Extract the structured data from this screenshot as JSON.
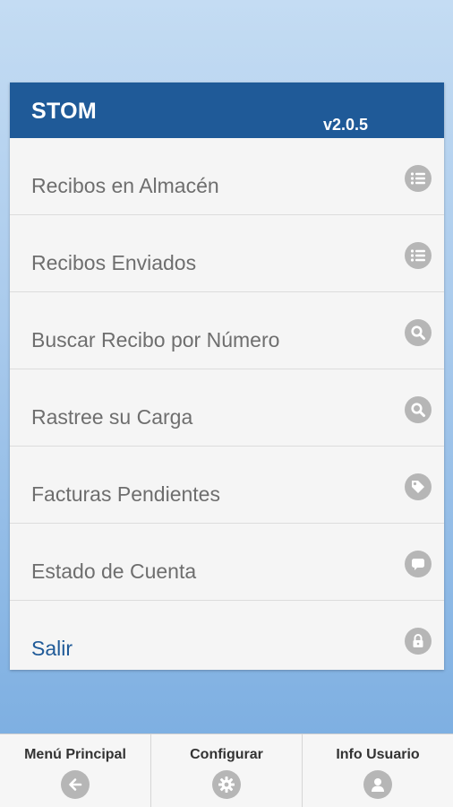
{
  "header": {
    "title": "STOM",
    "version": "v2.0.5"
  },
  "menu": {
    "items": [
      {
        "label": "Recibos en Almacén",
        "icon": "list-icon"
      },
      {
        "label": "Recibos Enviados",
        "icon": "list-icon"
      },
      {
        "label": "Buscar Recibo por Número",
        "icon": "search-icon"
      },
      {
        "label": "Rastree su Carga",
        "icon": "search-icon"
      },
      {
        "label": "Facturas Pendientes",
        "icon": "tag-icon"
      },
      {
        "label": "Estado de Cuenta",
        "icon": "comment-icon"
      },
      {
        "label": "Salir",
        "icon": "lock-icon"
      }
    ]
  },
  "tabbar": {
    "tabs": [
      {
        "label": "Menú Principal",
        "icon": "arrow-left-icon"
      },
      {
        "label": "Configurar",
        "icon": "gear-icon"
      },
      {
        "label": "Info Usuario",
        "icon": "user-icon"
      }
    ]
  },
  "colors": {
    "header_bg": "#1f5a98",
    "logout_text": "#1f5a98",
    "icon_gray": "#b6b6b6"
  }
}
